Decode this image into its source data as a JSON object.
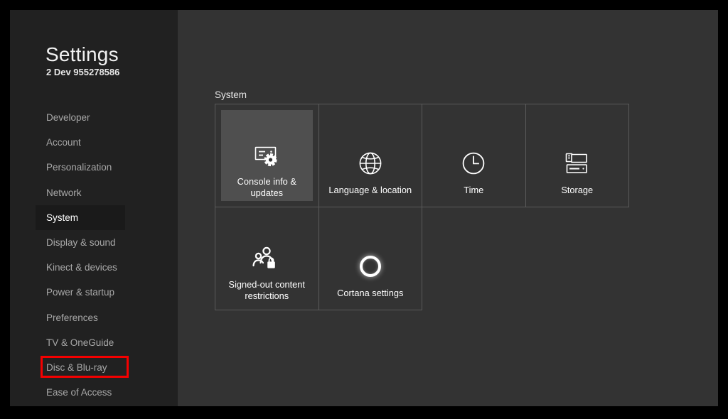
{
  "window": {
    "app_title": "Settings",
    "app_subtitle": "2 Dev 955278586"
  },
  "sidebar": {
    "items": [
      {
        "label": "Developer",
        "selected": false,
        "annotated": false
      },
      {
        "label": "Account",
        "selected": false,
        "annotated": false
      },
      {
        "label": "Personalization",
        "selected": false,
        "annotated": false
      },
      {
        "label": "Network",
        "selected": false,
        "annotated": false
      },
      {
        "label": "System",
        "selected": true,
        "annotated": false
      },
      {
        "label": "Display & sound",
        "selected": false,
        "annotated": false
      },
      {
        "label": "Kinect & devices",
        "selected": false,
        "annotated": false
      },
      {
        "label": "Power & startup",
        "selected": false,
        "annotated": false
      },
      {
        "label": "Preferences",
        "selected": false,
        "annotated": false
      },
      {
        "label": "TV & OneGuide",
        "selected": false,
        "annotated": false
      },
      {
        "label": "Disc & Blu-ray",
        "selected": false,
        "annotated": true
      },
      {
        "label": "Ease of Access",
        "selected": false,
        "annotated": false
      }
    ]
  },
  "main": {
    "section_title": "System",
    "tiles": [
      {
        "label": "Console info & updates",
        "icon": "console-settings-icon",
        "selected": true,
        "two_line": true
      },
      {
        "label": "Language & location",
        "icon": "globe-icon",
        "selected": false,
        "two_line": false
      },
      {
        "label": "Time",
        "icon": "clock-icon",
        "selected": false,
        "two_line": false
      },
      {
        "label": "Storage",
        "icon": "storage-drives-icon",
        "selected": false,
        "two_line": false
      },
      {
        "label": "Signed-out content restrictions",
        "icon": "people-lock-icon",
        "selected": false,
        "two_line": true
      },
      {
        "label": "Cortana settings",
        "icon": "cortana-ring-icon",
        "selected": false,
        "two_line": false
      }
    ]
  },
  "colors": {
    "frame": "#000000",
    "sidebar_bg": "#212121",
    "content_bg": "#333333",
    "tile_border": "#5a5a5a",
    "tile_selected_bg": "#4f4f4f",
    "nav_selected_bg": "#1a1a1a",
    "annotation_red": "#f40000",
    "text_primary": "#ffffff",
    "text_secondary": "#a8a8a8"
  }
}
